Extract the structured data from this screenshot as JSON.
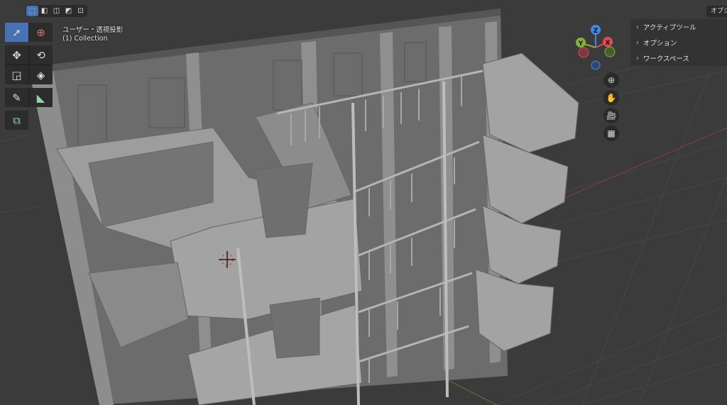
{
  "header": {
    "select_modes": [
      "set",
      "extend",
      "subtract",
      "invert",
      "intersect"
    ],
    "options_button": "オプション"
  },
  "viewport": {
    "view_name": "ユーザー・透視投影",
    "collection": "(1) Collection"
  },
  "toolbar": {
    "tools": [
      "select-box",
      "cursor",
      "move",
      "rotate",
      "scale",
      "transform",
      "annotate",
      "measure",
      "add-cube"
    ],
    "active": "select-box"
  },
  "side_panel": {
    "items": [
      "アクティブツール",
      "オプション",
      "ワークスペース"
    ]
  },
  "gizmo": {
    "axes": {
      "x": "X",
      "y": "Y",
      "z": "Z"
    },
    "colors": {
      "x": "#e24b55",
      "y": "#84b33a",
      "z": "#3f8ae0"
    }
  },
  "nav_buttons": [
    "zoom",
    "pan",
    "camera",
    "grid-view"
  ]
}
